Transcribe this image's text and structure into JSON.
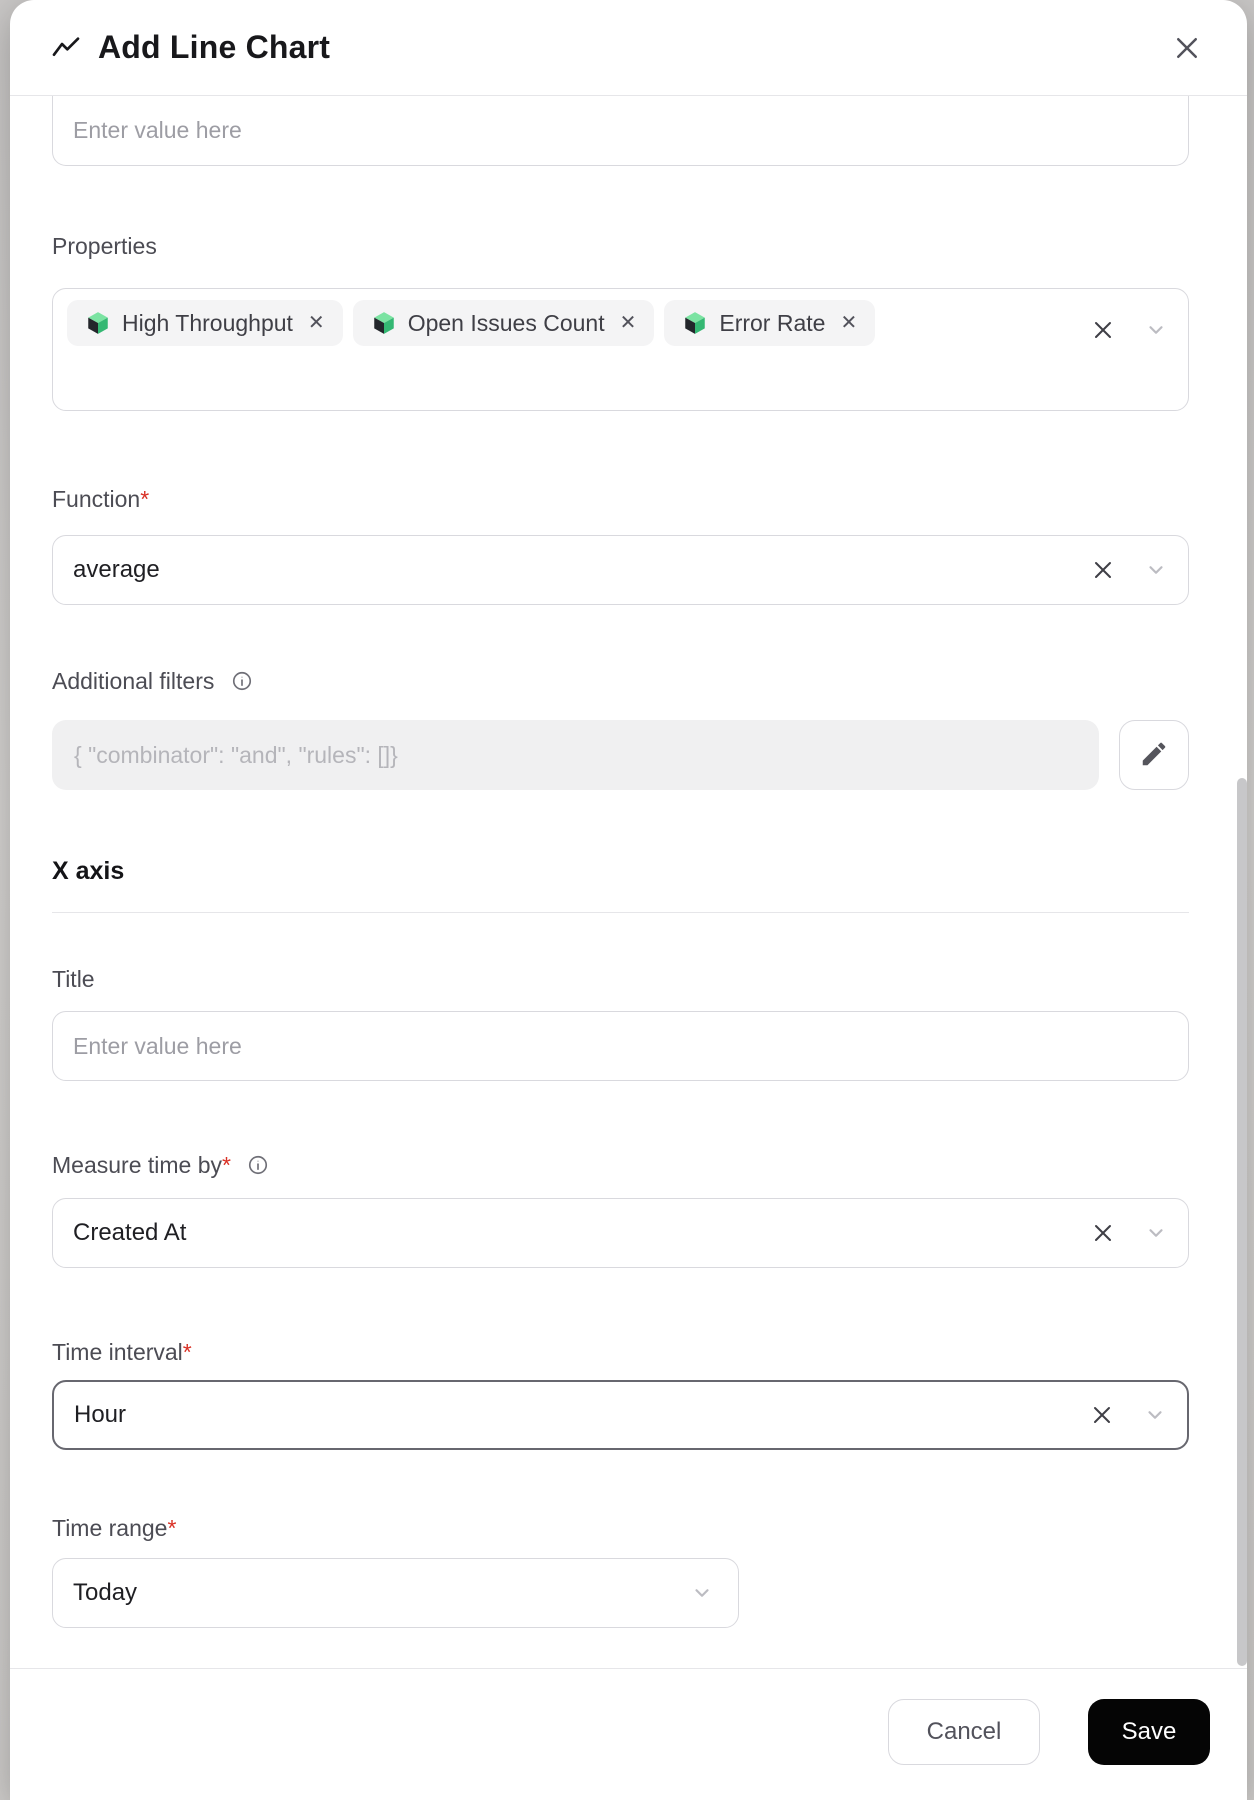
{
  "header": {
    "title": "Add Line Chart"
  },
  "form": {
    "top_input": {
      "placeholder": "Enter value here"
    },
    "properties": {
      "label": "Properties",
      "chips": [
        {
          "label": "High Throughput",
          "remove": "✕"
        },
        {
          "label": "Open Issues Count",
          "remove": "✕"
        },
        {
          "label": "Error Rate",
          "remove": "✕"
        }
      ]
    },
    "function": {
      "label": "Function",
      "required": "*",
      "value": "average"
    },
    "additional_filters": {
      "label": "Additional filters",
      "value": "{  \"combinator\": \"and\",  \"rules\": []}"
    },
    "x_axis": {
      "heading": "X axis"
    },
    "title_field": {
      "label": "Title",
      "placeholder": "Enter value here"
    },
    "measure_time_by": {
      "label": "Measure time by",
      "required": "*",
      "value": "Created At"
    },
    "time_interval": {
      "label": "Time interval",
      "required": "*",
      "value": "Hour"
    },
    "time_range": {
      "label": "Time range",
      "required": "*",
      "value": "Today"
    }
  },
  "footer": {
    "cancel_label": "Cancel",
    "save_label": "Save"
  },
  "colors": {
    "accent_dark": "#050505",
    "required_red": "#d93025",
    "chip_bg": "#f4f4f5",
    "disabled_bg": "#f0f0f1",
    "border": "#d9d9de",
    "icon_green_light": "#7be3a2",
    "icon_green": "#34b873",
    "icon_dark": "#23262b"
  }
}
